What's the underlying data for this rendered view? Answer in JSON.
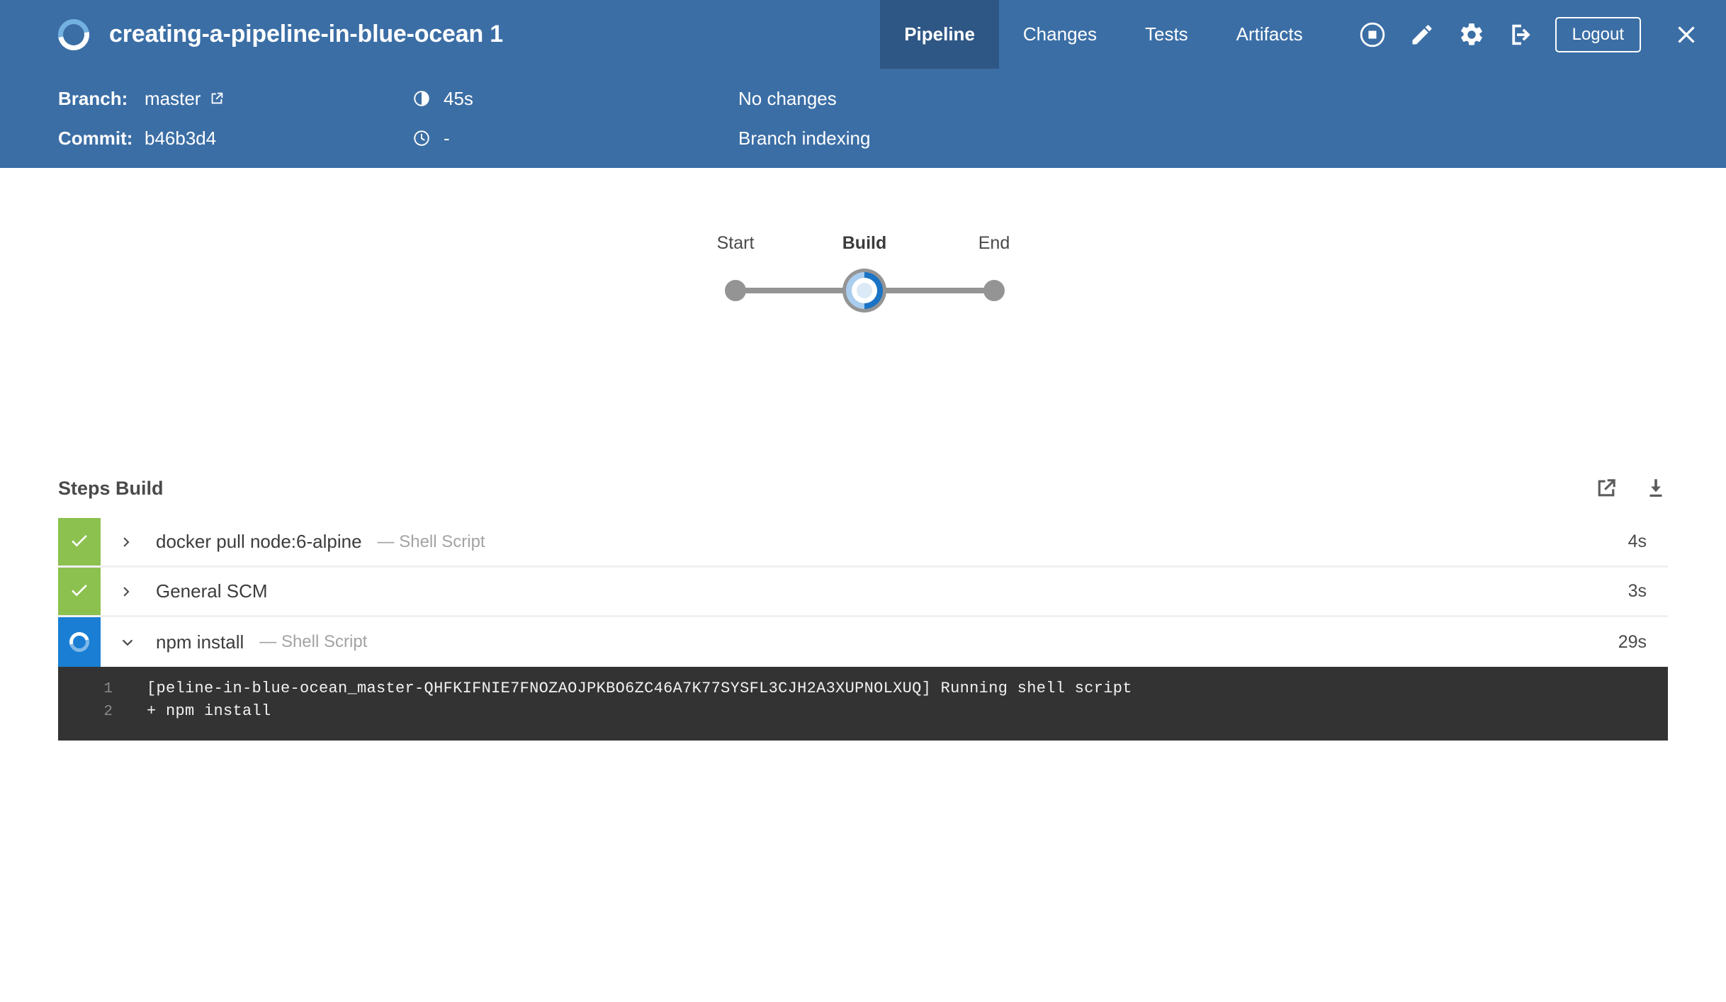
{
  "header": {
    "logo_icon": "pipeline-running-spinner-icon",
    "title": "creating-a-pipeline-in-blue-ocean 1",
    "tabs": [
      {
        "label": "Pipeline",
        "active": true
      },
      {
        "label": "Changes",
        "active": false
      },
      {
        "label": "Tests",
        "active": false
      },
      {
        "label": "Artifacts",
        "active": false
      }
    ],
    "actions": [
      {
        "name": "stop-build-icon",
        "label": "Stop"
      },
      {
        "name": "edit-pipeline-icon",
        "label": "Edit"
      },
      {
        "name": "gear-icon",
        "label": "Settings"
      },
      {
        "name": "logout-arrow-icon",
        "label": "Log out"
      }
    ],
    "logout_label": "Logout",
    "close_label": "Close"
  },
  "meta": {
    "branch_label": "Branch:",
    "branch_value": "master",
    "branch_link_icon": "external-link-icon",
    "commit_label": "Commit:",
    "commit_value": "b46b3d4",
    "duration_icon": "half-clock-icon",
    "duration_value": "45s",
    "time_icon": "clock-icon",
    "time_value": "-",
    "changes_text": "No changes",
    "cause_text": "Branch indexing"
  },
  "graph": {
    "nodes": [
      {
        "label": "Start",
        "state": "idle"
      },
      {
        "label": "Build",
        "state": "running"
      },
      {
        "label": "End",
        "state": "idle"
      }
    ]
  },
  "steps": {
    "title": "Steps Build",
    "open_icon": "open-in-new-icon",
    "download_icon": "download-icon",
    "rows": [
      {
        "status": "success",
        "status_icon": "check-icon",
        "chevron": "chevron-right-icon",
        "name": "docker pull node:6-alpine",
        "type": "— Shell Script",
        "duration": "4s",
        "expanded": false
      },
      {
        "status": "success",
        "status_icon": "check-icon",
        "chevron": "chevron-right-icon",
        "name": "General SCM",
        "type": "",
        "duration": "3s",
        "expanded": false
      },
      {
        "status": "running",
        "status_icon": "spinner-icon",
        "chevron": "chevron-down-icon",
        "name": "npm install",
        "type": "— Shell Script",
        "duration": "29s",
        "expanded": true
      }
    ]
  },
  "log": {
    "lines": [
      {
        "no": "1",
        "text": "[peline-in-blue-ocean_master-QHFKIFNIE7FNOZAOJPKBO6ZC46A7K77SYSFL3CJH2A3XUPNOLXUQ] Running shell script"
      },
      {
        "no": "2",
        "text": "+ npm install"
      }
    ]
  },
  "colors": {
    "header_blue": "#3b6ea5",
    "active_tab_blue": "#2f5785",
    "success_green": "#8cc04f",
    "running_blue": "#1a7fd4",
    "log_bg": "#333333",
    "accent_blue": "#1a73c4"
  }
}
